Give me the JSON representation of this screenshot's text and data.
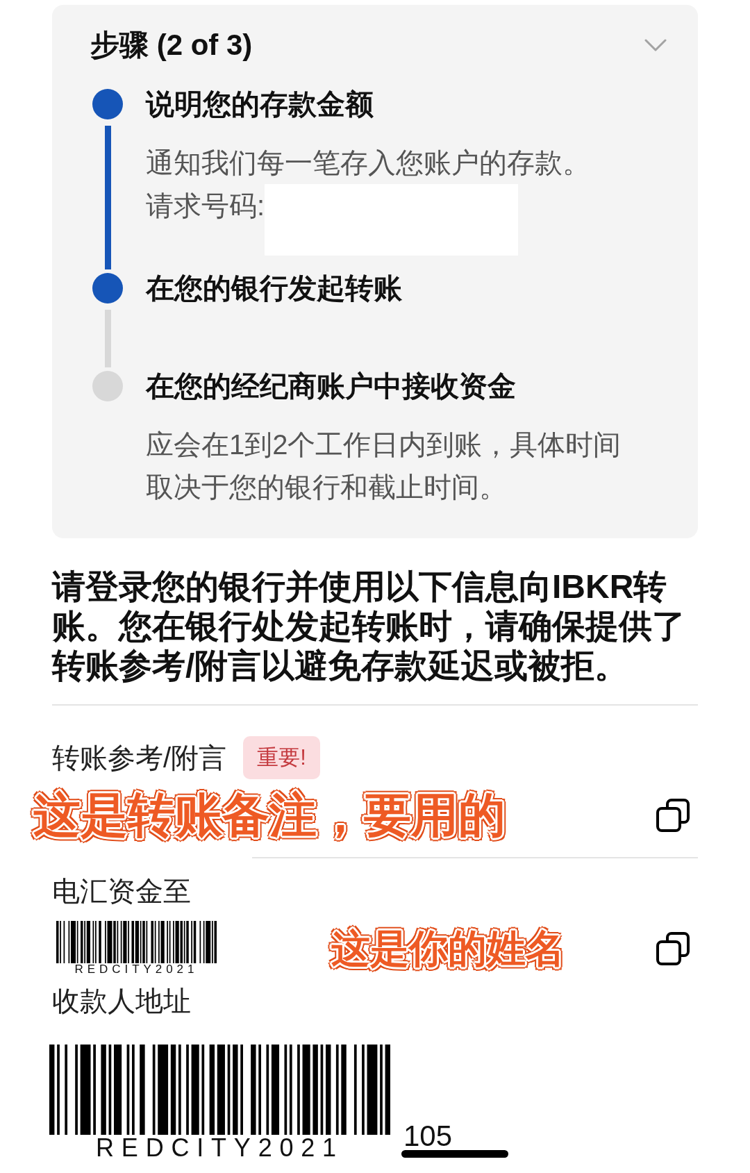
{
  "steps_card": {
    "title": "步骤 (2 of 3)",
    "steps": [
      {
        "title": "说明您的存款金额",
        "reached": true,
        "description": "通知我们每一笔存入您账户的存款。",
        "request_label": "请求号码:"
      },
      {
        "title": "在您的银行发起转账",
        "reached": true
      },
      {
        "title": "在您的经纪商账户中接收资金",
        "reached": false,
        "description": "应会在1到2个工作日内到账，具体时间取决于您的银行和截止时间。"
      }
    ]
  },
  "instructions": "请登录您的银行并使用以下信息向IBKR转账。您在银行处发起转账时，请确保提供了转账参考/附言以避免存款延迟或被拒。",
  "transfer_reference": {
    "label": "转账参考/附言",
    "badge": "重要!",
    "annotation": "这是转账备注，要用的",
    "copyable": true
  },
  "wire_to": {
    "label": "电汇资金至",
    "sticker": "REDCITY2021",
    "annotation": "这是你的姓名",
    "copyable": true
  },
  "beneficiary_address": {
    "label": "收款人地址",
    "sticker": "REDCITY2021",
    "value": "105"
  }
}
